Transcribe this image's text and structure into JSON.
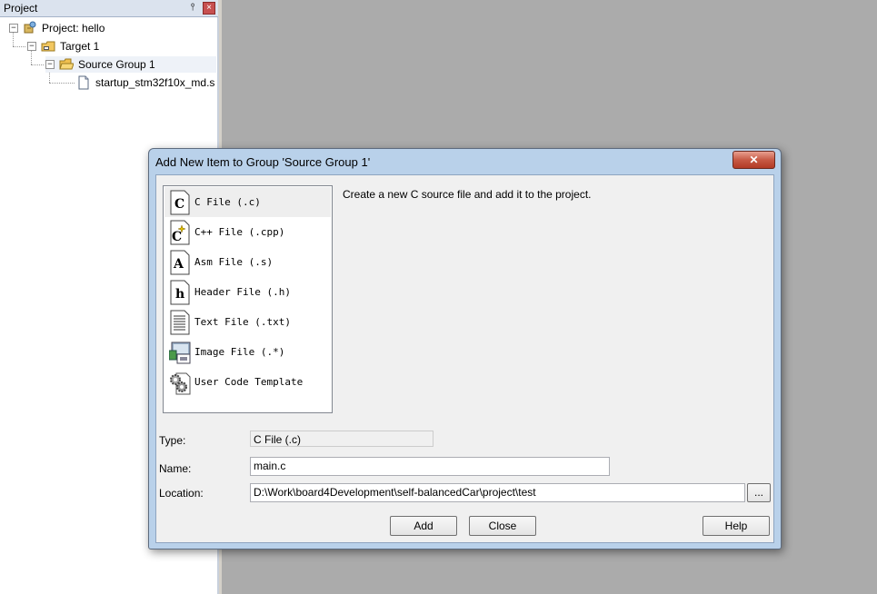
{
  "project_panel": {
    "title": "Project",
    "pin_glyph": "⫯",
    "close_glyph": "×",
    "tree": {
      "project": "Project: hello",
      "target": "Target 1",
      "group": "Source Group 1",
      "file": "startup_stm32f10x_md.s",
      "collapse_glyph": "−"
    }
  },
  "dialog": {
    "title": "Add New Item to Group 'Source Group 1'",
    "close_glyph": "✕",
    "items": [
      {
        "label": "C File (.c)",
        "icon_letter": "C"
      },
      {
        "label": "C++ File (.cpp)",
        "icon_letter": "C"
      },
      {
        "label": "Asm File (.s)",
        "icon_letter": "A"
      },
      {
        "label": "Header File (.h)",
        "icon_letter": "h"
      },
      {
        "label": "Text File (.txt)",
        "icon_letter": ""
      },
      {
        "label": "Image File (.*)",
        "icon_letter": ""
      },
      {
        "label": "User Code Template",
        "icon_letter": ""
      }
    ],
    "selected_index": 0,
    "description": "Create a new C source file and add it to the project.",
    "type_label": "Type:",
    "type_value": "C File (.c)",
    "name_label": "Name:",
    "name_value": "main.c",
    "location_label": "Location:",
    "location_value": "D:\\Work\\board4Development\\self-balancedCar\\project\\test",
    "browse_label": "...",
    "add_label": "Add",
    "close_label": "Close",
    "help_label": "Help"
  }
}
